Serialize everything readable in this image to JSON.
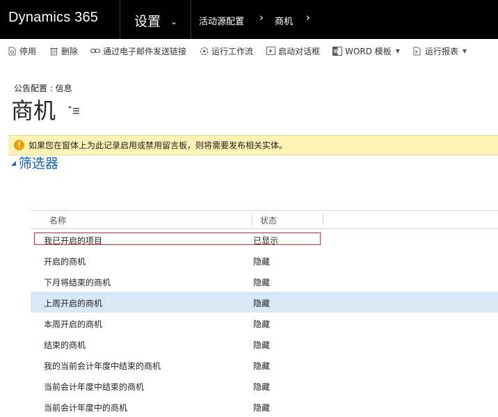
{
  "app": {
    "brand": "Dynamics 365"
  },
  "nav": {
    "area": "设置",
    "breadcrumb": [
      "活动源配置",
      "商机"
    ]
  },
  "commands": [
    {
      "label": "停用",
      "icon": "deactivate-icon"
    },
    {
      "label": "删除",
      "icon": "delete-icon"
    },
    {
      "label": "通过电子邮件发送链接",
      "icon": "link-icon"
    },
    {
      "label": "运行工作流",
      "icon": "workflow-icon"
    },
    {
      "label": "启动对话框",
      "icon": "dialog-icon"
    },
    {
      "label": "WORD 模板",
      "icon": "word-icon"
    },
    {
      "label": "运行报表",
      "icon": "report-icon"
    }
  ],
  "header": {
    "subtitle": "公告配置 : 信息",
    "title": "商机"
  },
  "notification": {
    "text": "如果您在窗体上为此记录启用或禁用留言板，则将需要发布相关实体。"
  },
  "filters": {
    "label": "筛选器"
  },
  "grid": {
    "columns": [
      "名称",
      "状态"
    ],
    "rows": [
      {
        "name": "我已开启的项目",
        "status": "已显示"
      },
      {
        "name": "开启的商机",
        "status": "隐藏"
      },
      {
        "name": "下月将结束的商机",
        "status": "隐藏"
      },
      {
        "name": "上周开启的商机",
        "status": "隐藏"
      },
      {
        "name": "本周开启的商机",
        "status": "隐藏"
      },
      {
        "name": "结束的商机",
        "status": "隐藏"
      },
      {
        "name": "我的当前会计年度中结束的商机",
        "status": "隐藏"
      },
      {
        "name": "当前会计年度中结束的商机",
        "status": "隐藏"
      },
      {
        "name": "当前会计年度中的商机",
        "status": "隐藏"
      }
    ]
  },
  "colors": {
    "topbar": "#000000",
    "notification_bg": "#fff2b5",
    "warning": "#e8a100",
    "link_blue": "#1160b7",
    "selected_row": "#d8e8f6",
    "highlight_border": "#d9233a"
  }
}
